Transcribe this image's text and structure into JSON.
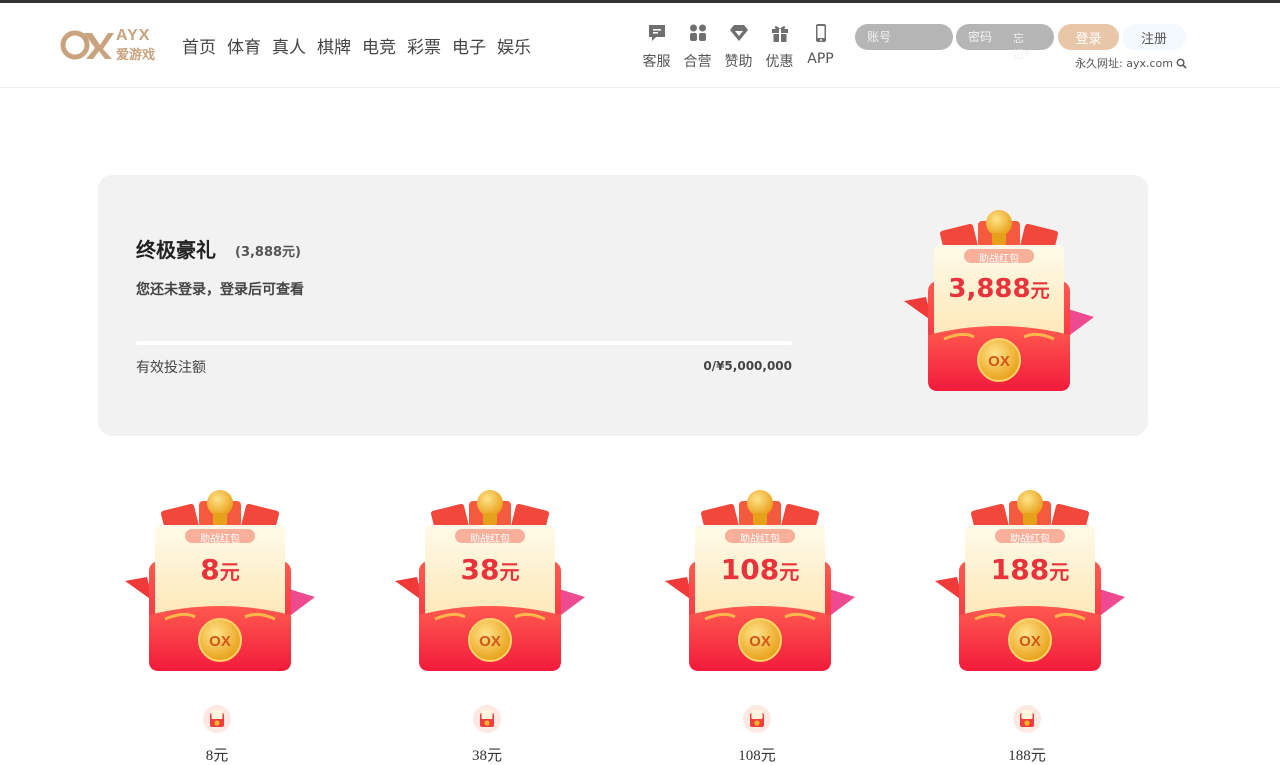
{
  "brand": {
    "logo_top": "AYX",
    "logo_bottom": "爱游戏"
  },
  "nav": [
    "首页",
    "体育",
    "真人",
    "棋牌",
    "电竞",
    "彩票",
    "电子",
    "娱乐"
  ],
  "icon_nav": [
    {
      "label": "客服",
      "icon": "chat-icon"
    },
    {
      "label": "合营",
      "icon": "partner-icon"
    },
    {
      "label": "赞助",
      "icon": "sponsor-icon"
    },
    {
      "label": "优惠",
      "icon": "gift-icon"
    },
    {
      "label": "APP",
      "icon": "phone-icon"
    }
  ],
  "login": {
    "account_placeholder": "账号",
    "password_placeholder": "密码",
    "forgot": "忘记?",
    "login_label": "登录",
    "register_label": "注册",
    "url_text": "永久网址: ayx.com"
  },
  "panel": {
    "title": "终极豪礼",
    "amount": "(3,888元)",
    "subtitle": "您还未登录，登录后可查看",
    "progress_label": "有效投注额",
    "progress_current": "0",
    "progress_target": "/¥5,000,000",
    "progress_fraction": 0,
    "envelope_tag": "助战红包",
    "envelope_amount": "3,888",
    "unit": "元"
  },
  "rewards": [
    {
      "amount": "8",
      "unit": "元",
      "tag": "助战红包",
      "label": "8元"
    },
    {
      "amount": "38",
      "unit": "元",
      "tag": "助战红包",
      "label": "38元"
    },
    {
      "amount": "108",
      "unit": "元",
      "tag": "助战红包",
      "label": "108元"
    },
    {
      "amount": "188",
      "unit": "元",
      "tag": "助战红包",
      "label": "188元"
    }
  ],
  "colors": {
    "accent": "#e8c7a8",
    "red": "#f02f3a",
    "gold": "#f4b423",
    "panel_bg": "#f2f2f3"
  }
}
